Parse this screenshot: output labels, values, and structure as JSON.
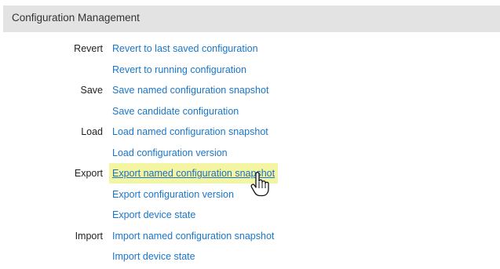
{
  "header": {
    "title": "Configuration Management"
  },
  "rows": [
    {
      "label": "Revert",
      "link": "Revert to last saved configuration"
    },
    {
      "label": "",
      "link": "Revert to running configuration"
    },
    {
      "label": "Save",
      "link": "Save named configuration snapshot"
    },
    {
      "label": "",
      "link": "Save candidate configuration"
    },
    {
      "label": "Load",
      "link": "Load named configuration snapshot"
    },
    {
      "label": "",
      "link": "Load configuration version"
    },
    {
      "label": "Export",
      "link": "Export named configuration snapshot"
    },
    {
      "label": "",
      "link": "Export configuration version"
    },
    {
      "label": "",
      "link": "Export device state"
    },
    {
      "label": "Import",
      "link": "Import named configuration snapshot"
    },
    {
      "label": "",
      "link": "Import device state"
    }
  ],
  "hovered_link": "Export named configuration snapshot",
  "colors": {
    "header_bg": "#e3e3e3",
    "link": "#1a76c9",
    "highlight": "#f4f5a3"
  },
  "cursor_icon": "hand-pointer-icon"
}
